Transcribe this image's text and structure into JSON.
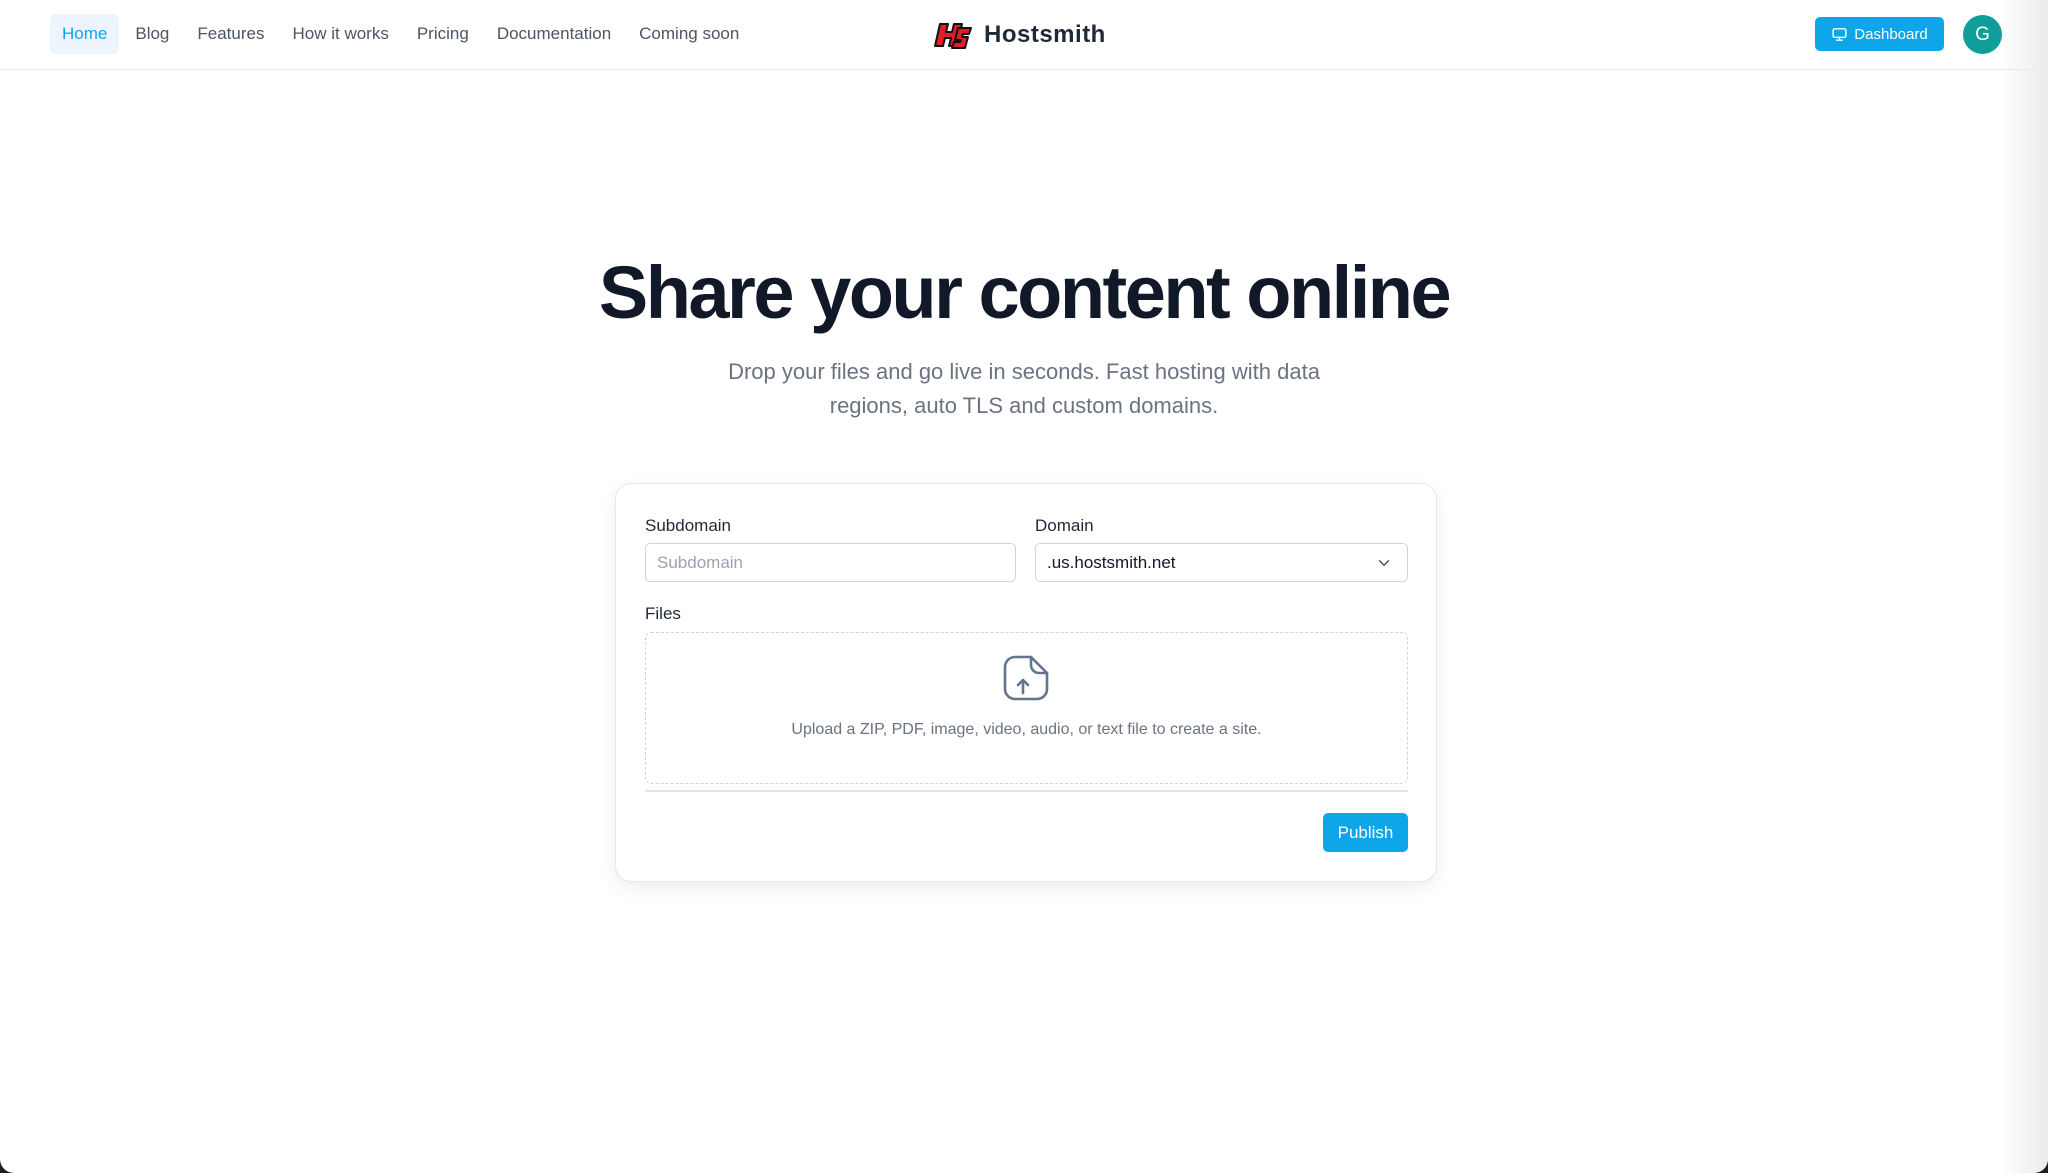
{
  "nav": {
    "links": [
      {
        "label": "Home",
        "active": true
      },
      {
        "label": "Blog",
        "active": false
      },
      {
        "label": "Features",
        "active": false
      },
      {
        "label": "How it works",
        "active": false
      },
      {
        "label": "Pricing",
        "active": false
      },
      {
        "label": "Documentation",
        "active": false
      },
      {
        "label": "Coming soon",
        "active": false
      }
    ],
    "brand": {
      "name": "Hostsmith",
      "logo_icon": "hs-logo-icon"
    },
    "dashboard_label": "Dashboard",
    "dashboard_icon": "monitor-icon",
    "avatar_initial": "G"
  },
  "hero": {
    "title": "Share your content online",
    "subtitle": "Drop your files and go live in seconds. Fast hosting with data regions, auto TLS and custom domains."
  },
  "form": {
    "subdomain_label": "Subdomain",
    "subdomain_placeholder": "Subdomain",
    "subdomain_value": "",
    "domain_label": "Domain",
    "domain_selected": ".us.hostsmith.net",
    "files_label": "Files",
    "upload_icon": "file-upload-icon",
    "dropzone_text": "Upload a ZIP, PDF, image, video, audio, or text file to create a site.",
    "publish_label": "Publish"
  },
  "colors": {
    "accent": "#0ea5e9",
    "avatar": "#0f9e9a",
    "title": "#111827",
    "muted": "#6b7280"
  }
}
